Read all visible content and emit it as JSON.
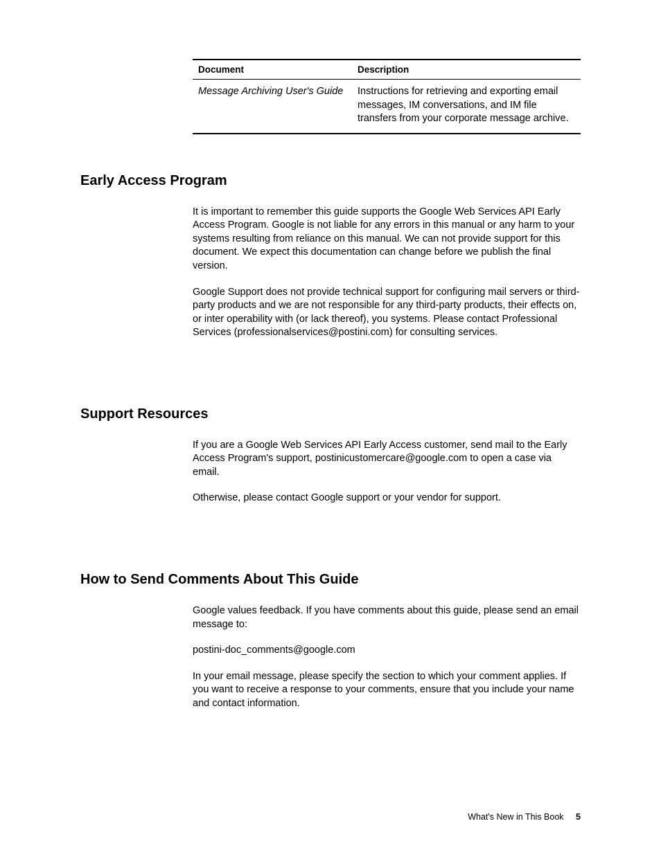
{
  "table": {
    "headers": {
      "col1": "Document",
      "col2": "Description"
    },
    "row": {
      "document": "Message Archiving User's Guide",
      "description": "Instructions for retrieving and exporting email messages, IM conversations, and IM file transfers from your corporate message archive."
    }
  },
  "sections": {
    "early_access": {
      "heading": "Early Access Program",
      "p1": "It is important to remember this guide supports the Google Web Services API Early Access Program. Google is not liable for any errors in this manual or any harm to your systems resulting from reliance on this manual. We can not provide support for this document. We expect this documentation can change before we publish the final version.",
      "p2": "Google Support does not provide technical support for configuring mail servers or third-party products and we are not responsible for any third-party products, their effects on, or inter operability with (or lack thereof), you systems. Please contact Professional Services (professionalservices@postini.com) for consulting services."
    },
    "support_resources": {
      "heading": "Support Resources",
      "p1": "If you are a Google Web Services API Early Access customer, send mail to the Early Access Program's support, postinicustomercare@google.com to open a case via email.",
      "p2": "Otherwise, please contact Google support or your vendor for support."
    },
    "comments": {
      "heading": "How to Send Comments About This Guide",
      "p1": "Google values feedback. If you have comments about this guide, please send an email message to:",
      "p2": "postini-doc_comments@google.com",
      "p3": "In your email message, please specify the section to which your comment applies. If you want to receive a response to your comments, ensure that you include your name and contact information."
    }
  },
  "footer": {
    "title": "What's New in This Book",
    "page": "5"
  }
}
